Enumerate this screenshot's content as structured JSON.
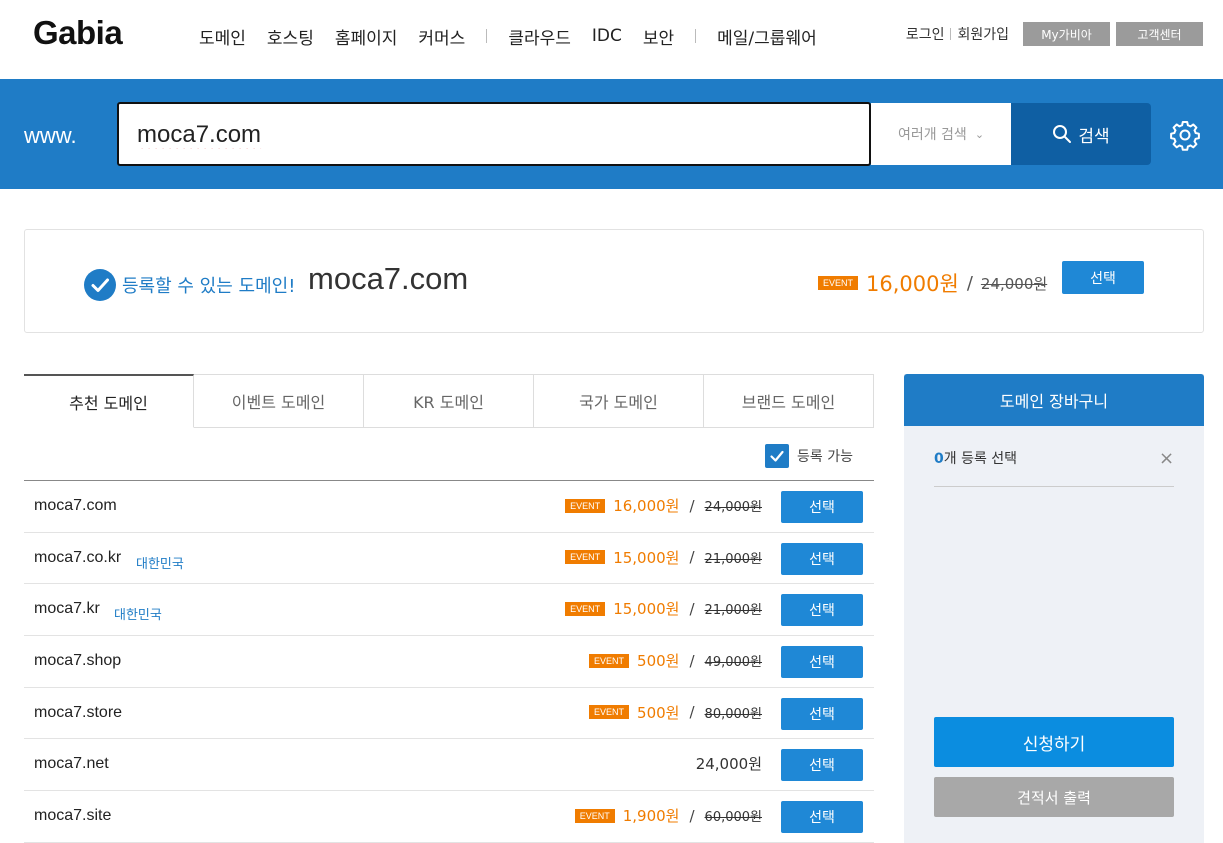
{
  "header": {
    "logo": "Gabia",
    "nav": [
      "도메인",
      "호스팅",
      "홈페이지",
      "커머스",
      "클라우드",
      "IDC",
      "보안",
      "메일/그룹웨어"
    ],
    "login": "로그인",
    "signup": "회원가입",
    "my_button": "My가비아",
    "support_button": "고객센터"
  },
  "search": {
    "prefix": "www.",
    "query": "moca7.com",
    "multi_label": "여러개 검색",
    "button_label": "검색"
  },
  "result": {
    "status": "등록할 수 있는 도메인!",
    "domain": "moca7.com",
    "badge": "EVENT",
    "price": "16,000원",
    "slash": "/",
    "old_price": "24,000원",
    "select_label": "선택"
  },
  "tabs": [
    "추천 도메인",
    "이벤트 도메인",
    "KR 도메인",
    "국가 도메인",
    "브랜드 도메인"
  ],
  "filter": {
    "label": "등록 가능",
    "checked": true
  },
  "rows": [
    {
      "domain": "moca7.com",
      "tag": "",
      "event": "EVENT",
      "price": "16,000원",
      "old": "24,000원",
      "select": "선택"
    },
    {
      "domain": "moca7.co.kr",
      "tag": "대한민국",
      "event": "EVENT",
      "price": "15,000원",
      "old": "21,000원",
      "select": "선택"
    },
    {
      "domain": "moca7.kr",
      "tag": "대한민국",
      "event": "EVENT",
      "price": "15,000원",
      "old": "21,000원",
      "select": "선택"
    },
    {
      "domain": "moca7.shop",
      "tag": "",
      "event": "EVENT",
      "price": "500원",
      "old": "49,000원",
      "select": "선택"
    },
    {
      "domain": "moca7.store",
      "tag": "",
      "event": "EVENT",
      "price": "500원",
      "old": "80,000원",
      "select": "선택"
    },
    {
      "domain": "moca7.net",
      "tag": "",
      "event": "",
      "price": "24,000원",
      "old": "",
      "select": "선택"
    },
    {
      "domain": "moca7.site",
      "tag": "",
      "event": "EVENT",
      "price": "1,900원",
      "old": "60,000원",
      "select": "선택"
    }
  ],
  "cart": {
    "title": "도메인 장바구니",
    "count": "0",
    "count_suffix": "개 등록 선택",
    "close": "×",
    "apply": "신청하기",
    "quote": "견적서 출력"
  },
  "icons": {
    "search": "magnifier-icon",
    "settings": "gear-icon",
    "check": "check-circle-icon",
    "chevron": "chevron-down-icon"
  },
  "colors": {
    "brand_blue": "#1f7cc6",
    "search_btn": "#0f5fa3",
    "event_orange": "#f07c00",
    "select_blue": "#1f88d6",
    "apply_blue": "#0b8de0"
  }
}
